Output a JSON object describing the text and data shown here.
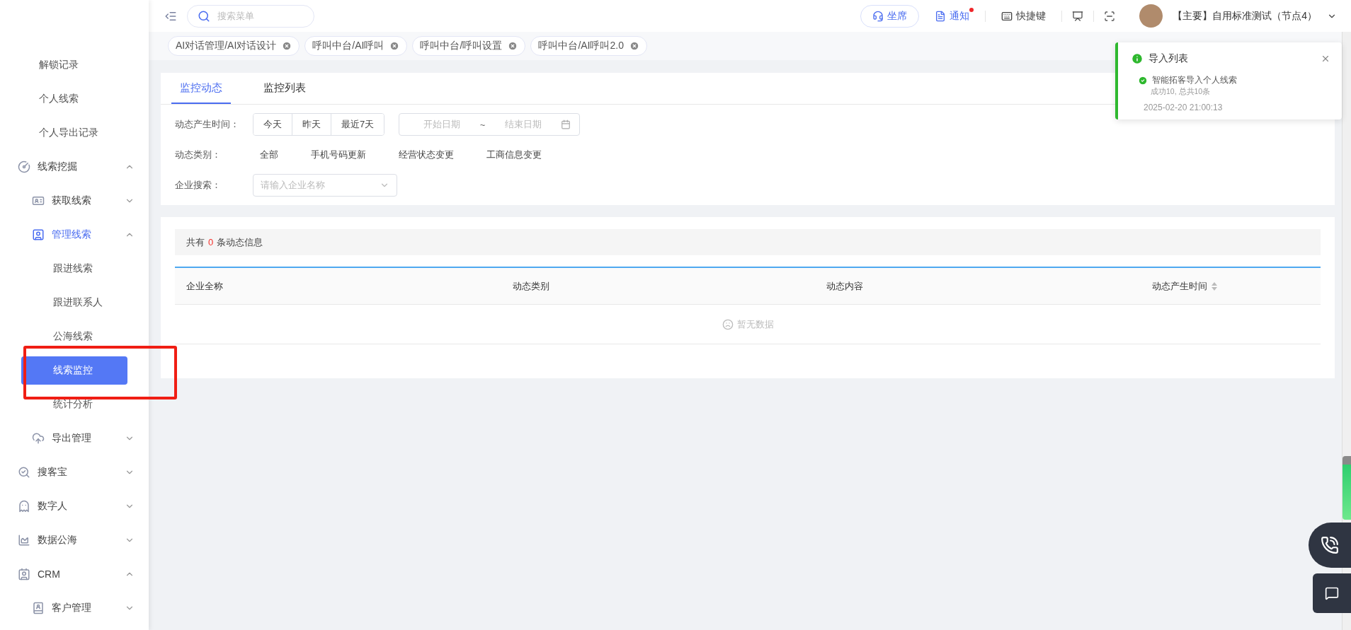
{
  "sidebar": {
    "items": [
      {
        "label": "解锁记录",
        "kind": "leaf",
        "selected": false
      },
      {
        "label": "个人线索",
        "kind": "leaf",
        "selected": false
      },
      {
        "label": "个人导出记录",
        "kind": "leaf",
        "selected": false
      },
      {
        "label": "线索挖掘",
        "kind": "group",
        "expanded": true,
        "active": false,
        "children": [
          {
            "label": "获取线索",
            "kind": "group",
            "expanded": false,
            "active": false
          },
          {
            "label": "管理线索",
            "kind": "group",
            "expanded": true,
            "active": true,
            "children": [
              {
                "label": "跟进线索",
                "kind": "leaf",
                "selected": false
              },
              {
                "label": "跟进联系人",
                "kind": "leaf",
                "selected": false
              },
              {
                "label": "公海线索",
                "kind": "leaf",
                "selected": false
              },
              {
                "label": "线索监控",
                "kind": "leaf",
                "selected": true
              },
              {
                "label": "统计分析",
                "kind": "leaf",
                "selected": false
              }
            ]
          },
          {
            "label": "导出管理",
            "kind": "group",
            "expanded": false,
            "active": false
          }
        ]
      },
      {
        "label": "搜客宝",
        "kind": "group",
        "expanded": false,
        "active": false
      },
      {
        "label": "数字人",
        "kind": "group",
        "expanded": false,
        "active": false
      },
      {
        "label": "数据公海",
        "kind": "group",
        "expanded": false,
        "active": false
      },
      {
        "label": "CRM",
        "kind": "group",
        "expanded": true,
        "active": false,
        "children": [
          {
            "label": "客户管理",
            "kind": "group",
            "expanded": false,
            "active": false
          }
        ]
      }
    ]
  },
  "header": {
    "search": {
      "placeholder": "搜索菜单"
    },
    "actions": [
      {
        "label": "坐席",
        "kind": "outlined",
        "badge": false
      },
      {
        "label": "通知",
        "kind": "link",
        "badge": true
      },
      {
        "label": "快捷键",
        "kind": "plain",
        "badge": false
      },
      {
        "kind": "icon"
      },
      {
        "kind": "icon"
      }
    ],
    "user": "【主要】自用标准测试（节点4）"
  },
  "open_tabs": [
    "AI对话管理/AI对话设计",
    "呼叫中台/AI呼叫",
    "呼叫中台/呼叫设置",
    "呼叫中台/AI呼叫2.0"
  ],
  "tabs": [
    {
      "label": "监控动态",
      "selected": true
    },
    {
      "label": "监控列表",
      "selected": false
    }
  ],
  "filters": {
    "time": {
      "label": "动态产生时间：",
      "presets": [
        "今天",
        "昨天",
        "最近7天"
      ],
      "start_placeholder": "开始日期",
      "separator": "~",
      "end_placeholder": "结束日期"
    },
    "type": {
      "label": "动态类别：",
      "options": [
        "全部",
        "手机号码更新",
        "经营状态变更",
        "工商信息变更"
      ]
    },
    "company": {
      "label": "企业搜索：",
      "placeholder": "请输入企业名称"
    }
  },
  "summary": {
    "prefix": "共有",
    "count": "0",
    "suffix": "条动态信息"
  },
  "table": {
    "columns": [
      {
        "label": "企业全称",
        "sortable": false
      },
      {
        "label": "动态类别",
        "sortable": false
      },
      {
        "label": "动态内容",
        "sortable": false
      },
      {
        "label": "动态产生时间",
        "sortable": true
      }
    ],
    "empty": "暂无数据"
  },
  "notification": {
    "title": "导入列表",
    "item": "智能拓客导入个人线索",
    "detail": "成功10, 总共10条",
    "time": "2025-02-20 21:00:13"
  }
}
